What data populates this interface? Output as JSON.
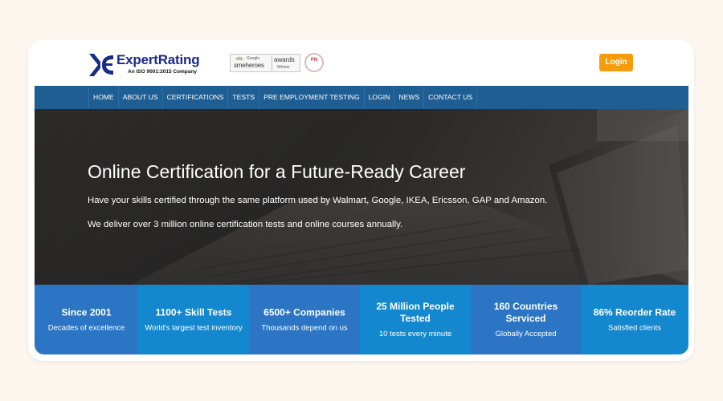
{
  "header": {
    "logo_text": "ExpertRating",
    "logo_subtext": "An ISO 9001:2015 Company",
    "sme_google": "Google",
    "sme_word": "smeheroes",
    "sme_awards": "awards",
    "sme_winner": "Winner",
    "seal_text": "PN",
    "login_label": "Login"
  },
  "nav": {
    "items": [
      "HOME",
      "ABOUT US",
      "CERTIFICATIONS",
      "TESTS",
      "PRE EMPLOYMENT TESTING",
      "LOGIN",
      "NEWS",
      "CONTACT US"
    ]
  },
  "hero": {
    "title": "Online Certification for a Future-Ready Career",
    "line1": "Have your skills certified through the same platform used by Walmart, Google, IKEA, Ericsson, GAP and Amazon.",
    "line2": "We deliver over 3 million online certification tests and online courses annually."
  },
  "stats": [
    {
      "title": "Since 2001",
      "sub": "Decades of excellence",
      "color": "#2b75c4"
    },
    {
      "title": "1100+ Skill Tests",
      "sub": "World's largest test inventory",
      "color": "#1488cf"
    },
    {
      "title": "6500+ Companies",
      "sub": "Thousands depend on us",
      "color": "#2b75c4"
    },
    {
      "title": "25 Million People Tested",
      "sub": "10 tests every minute",
      "color": "#1488cf"
    },
    {
      "title": "160 Countries Serviced",
      "sub": "Globally Accepted",
      "color": "#2b75c4"
    },
    {
      "title": "86% Reorder Rate",
      "sub": "Satisfied clients",
      "color": "#1488cf"
    }
  ],
  "colors": {
    "nav_bg": "#1f5e93",
    "login_bg": "#f59c0b",
    "logo_blue": "#1a2a8a",
    "page_bg": "#fdf6ee"
  }
}
